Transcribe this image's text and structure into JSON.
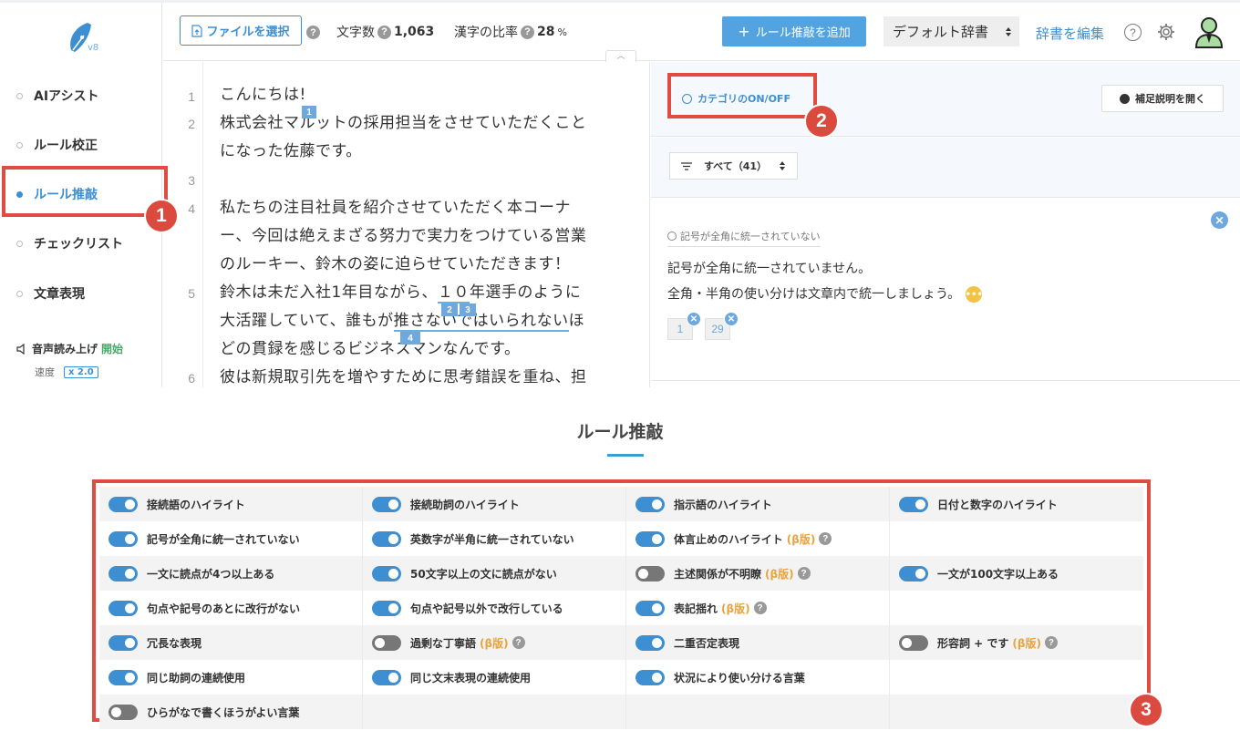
{
  "app": {
    "version": "v8"
  },
  "sidebar": {
    "items": [
      {
        "label": "AIアシスト",
        "active": false
      },
      {
        "label": "ルール校正",
        "active": false
      },
      {
        "label": "ルール推敲",
        "active": true
      },
      {
        "label": "チェックリスト",
        "active": false
      },
      {
        "label": "文章表現",
        "active": false
      }
    ],
    "voice_label": "音声読み上げ",
    "voice_start": "開始",
    "speed_label": "速度",
    "speed_value": "x 2.0"
  },
  "toolbar": {
    "file_button": "ファイルを選択",
    "char_count_label": "文字数",
    "char_count_value": "1,063",
    "kanji_ratio_label": "漢字の比率",
    "kanji_ratio_value": "28",
    "kanji_ratio_unit": "%",
    "add_rule_button": "ルール推敲を追加",
    "dict_select": "デフォルト辞書",
    "edit_dict_link": "辞書を編集"
  },
  "editor": {
    "lines": [
      {
        "num": "1",
        "text": "こんにちは!"
      },
      {
        "num": "2",
        "text": "株式会社マルットの採用担当をさせていただくこと"
      },
      {
        "num": "",
        "text": "になった佐藤です。"
      },
      {
        "num": "3",
        "text": ""
      },
      {
        "num": "4",
        "text": "私たちの注目社員を紹介させていただく本コーナ"
      },
      {
        "num": "",
        "text": "ー、今回は絶えまざる努力で実力をつけている営業"
      },
      {
        "num": "",
        "text": "のルーキー、鈴木の姿に迫らせていただきます！"
      },
      {
        "num": "5",
        "text_a": "鈴木は未だ入社1年目ながら、",
        "text_b": "１０",
        "text_c": "年選手のように"
      },
      {
        "num": "",
        "text_a": "大活躍していて、誰もが",
        "text_b": "推さないではいられない",
        "text_c": "ほ"
      },
      {
        "num": "",
        "text": "どの貫録を感じるビジネスマンなんです。"
      },
      {
        "num": "6",
        "text": "彼は新規取引先を増やすために思考錯誤を重ね、担"
      }
    ],
    "markers": [
      "1",
      "2",
      "3",
      "4"
    ]
  },
  "panel": {
    "category_toggle": "カテゴリのON/OFF",
    "supplement_button": "補足説明を開く",
    "filter_label": "すべて（41）",
    "card": {
      "tag": "記号が全角に統一されていない",
      "message_1": "記号が全角に統一されていません。",
      "message_2": "全角・半角の使い分けは文章内で統一しましょう。",
      "refs": [
        "1",
        "29"
      ]
    }
  },
  "callouts": [
    "1",
    "2",
    "3"
  ],
  "rules_section": {
    "title": "ルール推敲",
    "rows": [
      [
        {
          "label": "接続語のハイライト",
          "on": true
        },
        {
          "label": "接続助詞のハイライト",
          "on": true
        },
        {
          "label": "指示語のハイライト",
          "on": true
        },
        {
          "label": "日付と数字のハイライト",
          "on": true
        }
      ],
      [
        {
          "label": "記号が全角に統一されていない",
          "on": true
        },
        {
          "label": "英数字が半角に統一されていない",
          "on": true
        },
        {
          "label": "体言止めのハイライト",
          "on": true,
          "beta": "(β版)",
          "help": true
        },
        null
      ],
      [
        {
          "label": "一文に読点が4つ以上ある",
          "on": true
        },
        {
          "label": "50文字以上の文に読点がない",
          "on": true
        },
        {
          "label": "主述関係が不明瞭",
          "on": false,
          "beta": "(β版)",
          "help": true
        },
        {
          "label": "一文が100文字以上ある",
          "on": true
        }
      ],
      [
        {
          "label": "句点や記号のあとに改行がない",
          "on": true
        },
        {
          "label": "句点や記号以外で改行している",
          "on": true
        },
        {
          "label": "表記揺れ",
          "on": true,
          "beta": "(β版)",
          "help": true
        },
        null
      ],
      [
        {
          "label": "冗長な表現",
          "on": true
        },
        {
          "label": "過剰な丁寧語",
          "on": false,
          "beta": "(β版)",
          "help": true
        },
        {
          "label": "二重否定表現",
          "on": true
        },
        {
          "label": "形容詞 + です",
          "on": false,
          "beta": "(β版)",
          "help": true
        }
      ],
      [
        {
          "label": "同じ助詞の連続使用",
          "on": true
        },
        {
          "label": "同じ文末表現の連続使用",
          "on": true
        },
        {
          "label": "状況により使い分ける言葉",
          "on": true
        },
        null
      ],
      [
        {
          "label": "ひらがなで書くほうがよい言葉",
          "on": false
        },
        null,
        null,
        null
      ]
    ]
  },
  "colors": {
    "accent": "#3d8fd1",
    "highlight_box": "#e04b44",
    "beta": "#e8a33d"
  }
}
